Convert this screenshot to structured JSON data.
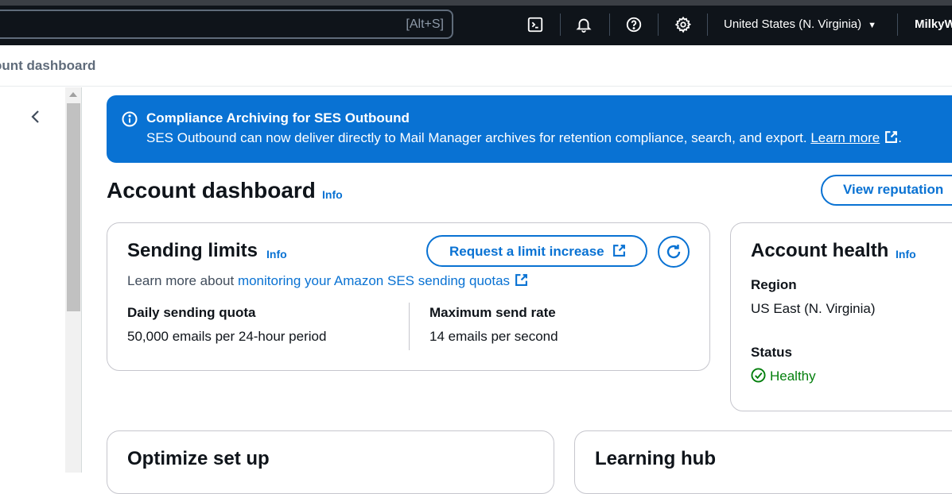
{
  "topbar": {
    "search_shortcut": "[Alt+S]",
    "region_label": "United States (N. Virginia)",
    "account_label": "MilkyW"
  },
  "breadcrumb": {
    "current": "ount dashboard"
  },
  "flash": {
    "title": "Compliance Archiving for SES Outbound",
    "body": "SES Outbound can now deliver directly to Mail Manager archives for retention compliance, search, and export.",
    "link": "Learn more",
    "trailing": "."
  },
  "header": {
    "title": "Account dashboard",
    "info": "Info",
    "view_reputation": "View reputation"
  },
  "sending_limits": {
    "title": "Sending limits",
    "info": "Info",
    "request_button": "Request a limit increase",
    "learn_prefix": "Learn more about",
    "learn_link": "monitoring your Amazon SES sending quotas",
    "daily_label": "Daily sending quota",
    "daily_value": "50,000 emails per 24-hour period",
    "rate_label": "Maximum send rate",
    "rate_value": "14 emails per second"
  },
  "account_health": {
    "title": "Account health",
    "info": "Info",
    "region_label": "Region",
    "region_value": "US East (N. Virginia)",
    "status_label": "Status",
    "status_value": "Healthy"
  },
  "optimize": {
    "title": "Optimize set up"
  },
  "learning_hub": {
    "title": "Learning hub"
  },
  "colors": {
    "topbar_bg": "#0f141a",
    "accent": "#0972d3",
    "success": "#037f0c"
  }
}
